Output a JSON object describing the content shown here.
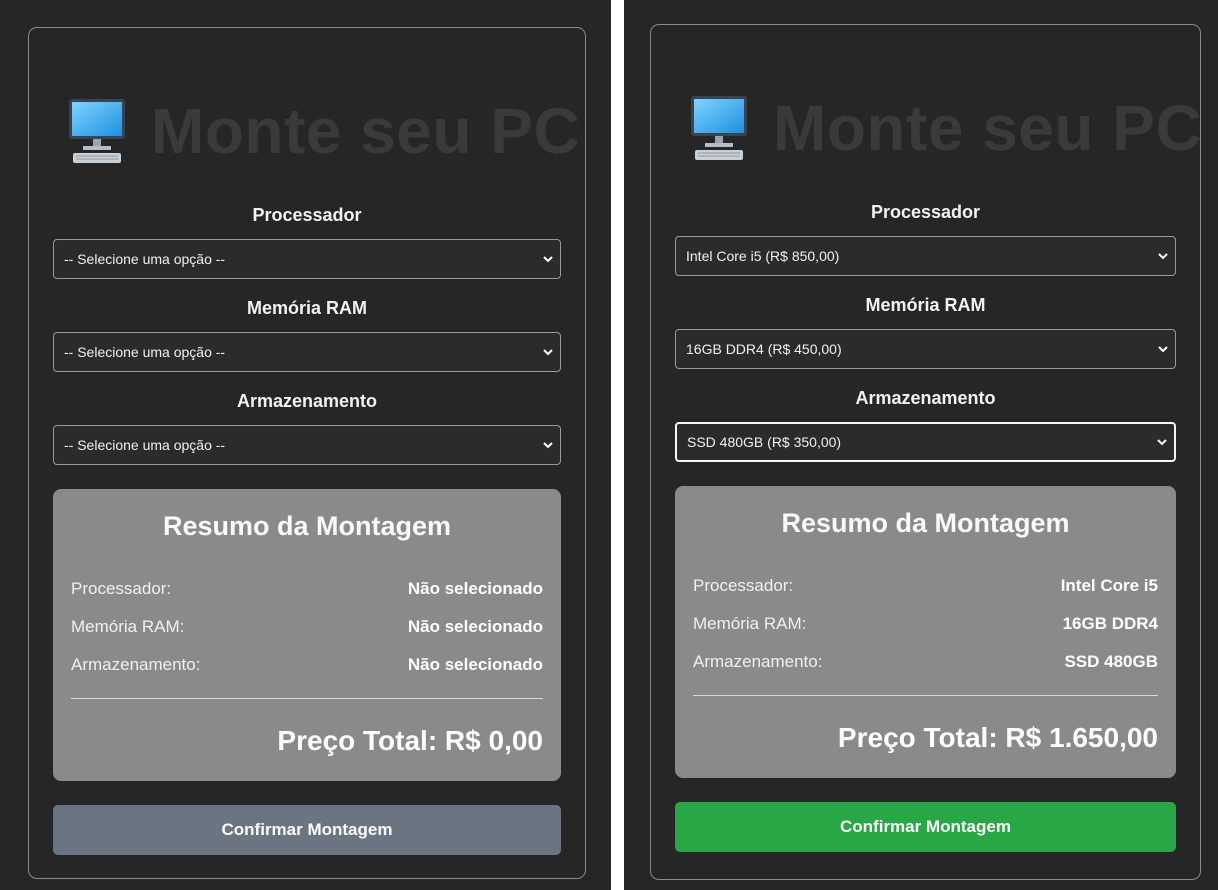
{
  "app": {
    "title": "Monte seu PC"
  },
  "labels": {
    "processor": "Processador",
    "ram": "Memória RAM",
    "storage": "Armazenamento"
  },
  "summary": {
    "title": "Resumo da Montagem",
    "processor_label": "Processador:",
    "ram_label": "Memória RAM:",
    "storage_label": "Armazenamento:"
  },
  "button": {
    "confirm": "Confirmar Montagem"
  },
  "left": {
    "processor_select": "-- Selecione uma opção --",
    "ram_select": "-- Selecione uma opção --",
    "storage_select": "-- Selecione uma opção --",
    "processor_value": "Não selecionado",
    "ram_value": "Não selecionado",
    "storage_value": "Não selecionado",
    "total": "Preço Total: R$ 0,00",
    "button_color": "#6b7582"
  },
  "right": {
    "processor_select": "Intel Core i5 (R$ 850,00)",
    "ram_select": "16GB DDR4 (R$ 450,00)",
    "storage_select": "SSD 480GB (R$ 350,00)",
    "processor_value": "Intel Core i5",
    "ram_value": "16GB DDR4",
    "storage_value": "SSD 480GB",
    "total": "Preço Total: R$ 1.650,00",
    "button_color": "#28a745"
  },
  "icons": {
    "header": "desktop-computer-icon",
    "select": "chevron-down-icon"
  }
}
